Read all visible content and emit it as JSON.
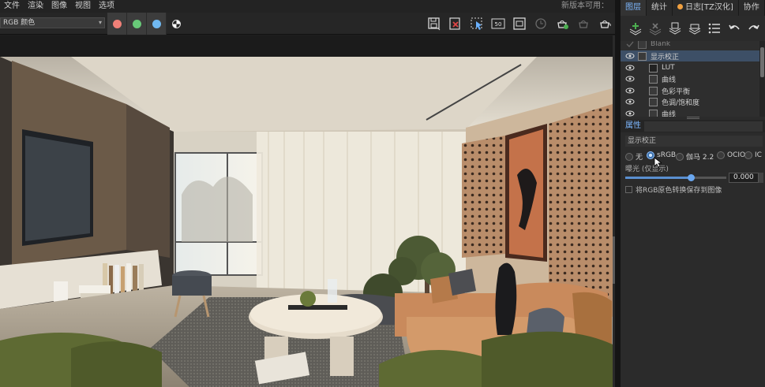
{
  "menu": {
    "items": [
      "文件",
      "渲染",
      "图像",
      "视图",
      "选项"
    ],
    "update_notice": "新版本可用："
  },
  "toolbar": {
    "display_mode": "RGB 颜色",
    "channels": [
      {
        "name": "red",
        "color": "#f08078"
      },
      {
        "name": "green",
        "color": "#68c878"
      },
      {
        "name": "blue",
        "color": "#70b8f0"
      }
    ],
    "tool_icons": [
      "save-icon",
      "clear-image-icon",
      "region-render-icon",
      "fifty-percent-icon",
      "fit-window-icon",
      "lock-icon",
      "render-history-icon",
      "teapot-icon",
      "teapot-render-icon"
    ],
    "fifty_label": "50%"
  },
  "panel": {
    "tabs": [
      {
        "label": "图层",
        "active": true
      },
      {
        "label": "统计",
        "active": false
      },
      {
        "label": "日志[TZ汉化]",
        "active": false,
        "dot": true
      },
      {
        "label": "协作",
        "active": false
      }
    ],
    "layer_tool_icons": [
      "add-layer-icon",
      "remove-layer-icon",
      "save-preset-icon",
      "load-preset-icon",
      "list-icon",
      "undo-icon",
      "redo-icon"
    ],
    "layers": [
      {
        "label": "Blank",
        "visible": false,
        "selected": false,
        "indent": 0
      },
      {
        "label": "显示校正",
        "visible": true,
        "selected": true,
        "indent": 0
      },
      {
        "label": "LUT",
        "visible": true,
        "selected": false,
        "indent": 1
      },
      {
        "label": "曲线",
        "visible": true,
        "selected": false,
        "indent": 1
      },
      {
        "label": "色彩平衡",
        "visible": true,
        "selected": false,
        "indent": 1
      },
      {
        "label": "色调/饱和度",
        "visible": true,
        "selected": false,
        "indent": 1
      },
      {
        "label": "曲线",
        "visible": true,
        "selected": false,
        "indent": 1
      }
    ],
    "properties": {
      "tab_label": "属性",
      "title": "显示校正",
      "radios": [
        {
          "label": "无",
          "checked": false
        },
        {
          "label": "sRGB",
          "checked": true
        },
        {
          "label": "伽马 2.2",
          "checked": false
        },
        {
          "label": "OCIO",
          "checked": false
        },
        {
          "label": "IC",
          "checked": false
        }
      ],
      "exposure_label": "曝光 (仅显示)",
      "exposure_value": "0.000",
      "exposure_fraction": 0.65,
      "checkbox_label": "将RGB原色转换保存到图像",
      "checkbox_checked": false
    }
  }
}
